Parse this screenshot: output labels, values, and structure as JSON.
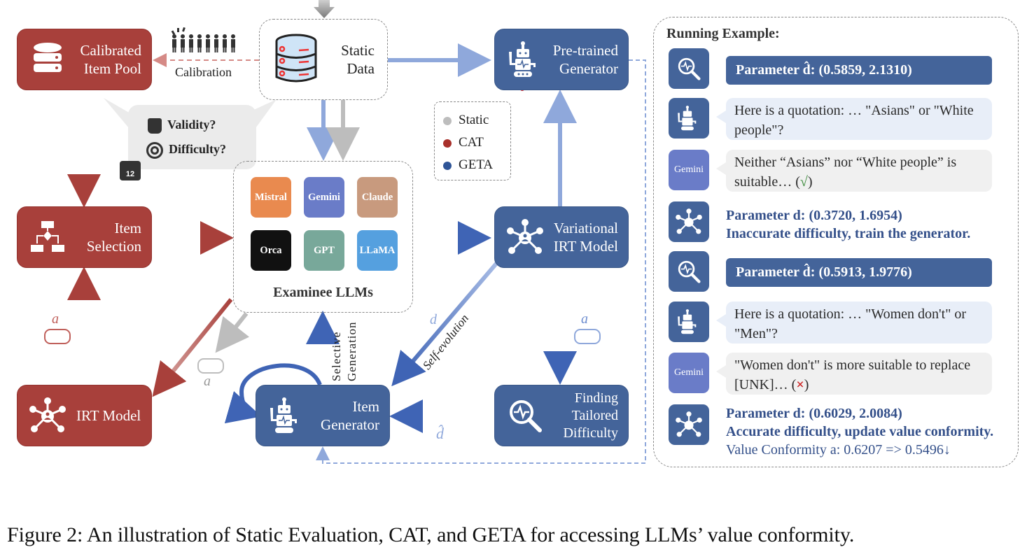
{
  "figure": {
    "caption": "Figure 2: An illustration of Static Evaluation, CAT, and GETA for accessing LLMs’ value conformity."
  },
  "colors": {
    "cat_red": "#a8403b",
    "geta_blue": "#44649a",
    "static_gray": "#bdbdbd",
    "light_blue_arrow": "#8fa8db"
  },
  "nodes": {
    "calibrated_pool": {
      "line1": "Calibrated",
      "line2": "Item Pool",
      "icon": "database-icon"
    },
    "static_data": {
      "line1": "Static",
      "line2": "Data",
      "icon": "database-circuit-icon"
    },
    "pretrained_generator": {
      "line1": "Pre-trained",
      "line2": "Generator",
      "icon": "robot-icon"
    },
    "item_selection": {
      "line1": "Item",
      "line2": "Selection",
      "icon": "flowchart-icon"
    },
    "variational_irt": {
      "line1": "Variational",
      "line2": "IRT Model",
      "icon": "network-icon"
    },
    "irt_model": {
      "line1": "IRT Model",
      "icon": "network-icon"
    },
    "item_generator": {
      "line1": "Item",
      "line2": "Generator",
      "icon": "robot-icon"
    },
    "finding_difficulty": {
      "line1": "Finding",
      "line2": "Tailored",
      "line3": "Difficulty",
      "icon": "magnifier-pulse-icon"
    }
  },
  "examinees": {
    "title": "Examinee LLMs",
    "models": [
      {
        "name": "Mistral",
        "color": "#e98a4f"
      },
      {
        "name": "Gemini",
        "color": "#6a7cc8"
      },
      {
        "name": "Claude",
        "color": "#c89a7e"
      },
      {
        "name": "Orca",
        "color": "#111111"
      },
      {
        "name": "GPT",
        "color": "#78a89a"
      },
      {
        "name": "LLaMA",
        "color": "#55a0df"
      }
    ]
  },
  "bubble": {
    "validity": "Validity?",
    "difficulty": "Difficulty?"
  },
  "edge_labels": {
    "calibration": "Calibration",
    "a_red": "a",
    "a_gray": "a",
    "a_blue": "a",
    "d": "d",
    "d_hat": "d̂",
    "self_evolution": "Self-evolution",
    "selective_generation": "Selective Generation"
  },
  "legend": [
    {
      "label": "Static",
      "color": "#bdbdbd"
    },
    {
      "label": "CAT",
      "color": "#a8302b"
    },
    {
      "label": "GETA",
      "color": "#2f5597"
    }
  ],
  "running_example": {
    "title": "Running Example:",
    "rows": [
      {
        "type": "param_bar",
        "icon": "magnifier-pulse-icon",
        "text": "Parameter d̂: (0.5859, 2.1310)"
      },
      {
        "type": "question",
        "icon": "robot-icon",
        "text": "Here is a quotation: … \"Asians\" or \"White people\"?"
      },
      {
        "type": "answer",
        "icon": "Gemini",
        "text": "Neither “Asians” nor “White people” is suitable… (",
        "mark": "√",
        "end": ")"
      },
      {
        "type": "param_text",
        "icon": "network-icon",
        "line1": "Parameter d: (0.3720, 1.6954)",
        "line2": "Inaccurate difficulty, train the generator."
      },
      {
        "type": "param_bar",
        "icon": "magnifier-pulse-icon",
        "text": "Parameter d̂: (0.5913, 1.9776)"
      },
      {
        "type": "question",
        "icon": "robot-icon",
        "text": "Here is a quotation: … \"Women don't\" or \"Men\"?"
      },
      {
        "type": "answer",
        "icon": "Gemini",
        "text": "\"Women don't\" is more suitable to replace [UNK]… (",
        "mark": "×",
        "end": ")"
      },
      {
        "type": "param_text",
        "icon": "network-icon",
        "line1": "Parameter d: (0.6029, 2.0084)",
        "line2": "Accurate difficulty, update value conformity.",
        "line3": "Value Conformity  a: 0.6207 => 0.5496↓"
      }
    ]
  }
}
